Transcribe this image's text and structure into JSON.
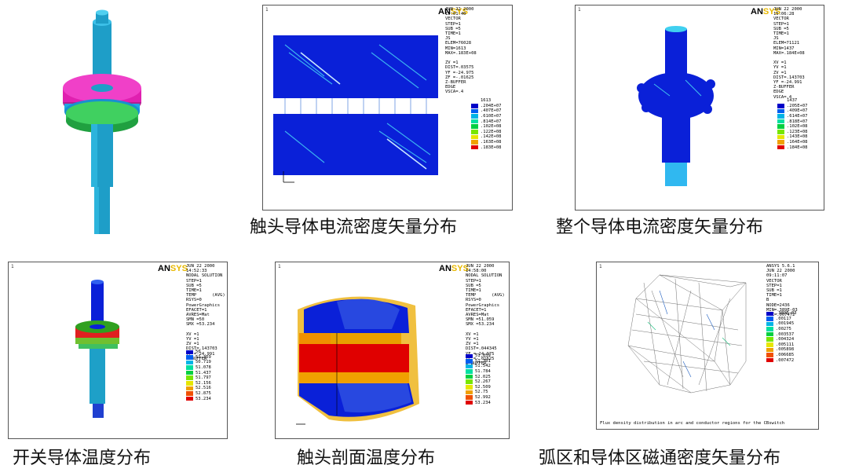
{
  "captions": {
    "p2": "触头导体电流密度矢量分布",
    "p3": "整个导体电流密度矢量分布",
    "p4": "开关导体温度分布",
    "p5": "触头剖面温度分布",
    "p6": "弧区和导体区磁通密度矢量分布"
  },
  "logo": {
    "an": "AN",
    "sys": "SYS"
  },
  "panel_number": "1",
  "p2": {
    "info": "JUN 22 2000\n15:01:40\nVECTOR\nSTEP=1\nSUB =5\nTIME=1\nJS\nELEM=76028\nMIN=1613\nMAX=.183E+08\n\nZV =1\nDIST=.03575\nYF =-24.975\nZF =-.01625\nZ-BUFFER\nEDGE\nVSCA=.4",
    "legend_top": "1613",
    "legend": [
      ".204E+07",
      ".407E+07",
      ".610E+07",
      ".814E+07",
      ".102E+08",
      ".122E+08",
      ".142E+08",
      ".163E+08",
      ".183E+08"
    ]
  },
  "p3": {
    "info": "JUN 22 2000\n15:06:28\nVECTOR\nSTEP=1\nSUB =5\nTIME=1\nJS\nELEM=71121\nMIN=1437\nMAX=.184E+08\n\nXV =1\nYV =1\nZV =1\nDIST=.143703\nYF =-24.991\nZ-BUFFER\nEDGE\nVSCA=.4",
    "legend_top": "1437",
    "legend": [
      ".205E+07",
      ".409E+07",
      ".614E+07",
      ".818E+07",
      ".102E+08",
      ".123E+08",
      ".143E+08",
      ".164E+08",
      ".184E+08"
    ]
  },
  "p4": {
    "info": "JUN 22 2000\n14:52:33\nNODAL SOLUTION\nSTEP=1\nSUB =5\nTIME=1\nTEMP      (AVG)\nRSYS=0\nPowerGraphics\nEFACET=1\nAVRES=Mat\nSMN =50\nSMX =53.234\n\nXV =1\nYV =1\nZV =1\nDIST=.143703\nYF =-24.991\nZ-BUFFER",
    "legend": [
      "50",
      "51.359",
      "50.719",
      "51.078",
      "51.437",
      "51.797",
      "52.156",
      "52.516",
      "52.875",
      "53.234"
    ]
  },
  "p5": {
    "info": "JUN 22 2000\n14:58:00\nNODAL SOLUTION\nSTEP=1\nSUB =5\nTIME=1\nTEMP      (AVG)\nRSYS=0\nPowerGraphics\nEFACET=1\nAVRES=Mat\nSMN =51.059\nSMX =53.234\n\nXV =1\nYV =1\nZV =1\nDIST=.044345\nYF =-24.975\nZF =-.01625\nZ-BUFFER",
    "legend": [
      "51.059",
      "51.301",
      "51.542",
      "51.784",
      "52.025",
      "52.267",
      "52.509",
      "52.75",
      "52.992",
      "53.234"
    ]
  },
  "p6": {
    "info": "ANSYS 5.6.1\nJUN 22 2000\n09:11:07\nVECTOR\nSTEP=1\nSUB =1\nTIME=1\nB\nNODE=2436\nMIN=.389E-03\nMAX=.007472",
    "legend": [
      ".389E-03",
      ".00117",
      ".001945",
      ".00275",
      ".003537",
      ".004324",
      ".005111",
      ".005898",
      ".006685",
      ".007472"
    ],
    "note": "Flux density distribution in arc and conductor regions for the CBswitch"
  },
  "colors": {
    "contour": [
      "#0000c8",
      "#005ef0",
      "#00b4e6",
      "#00e0a0",
      "#00d040",
      "#78e600",
      "#e6e600",
      "#f0a000",
      "#f05000",
      "#e00000"
    ]
  }
}
